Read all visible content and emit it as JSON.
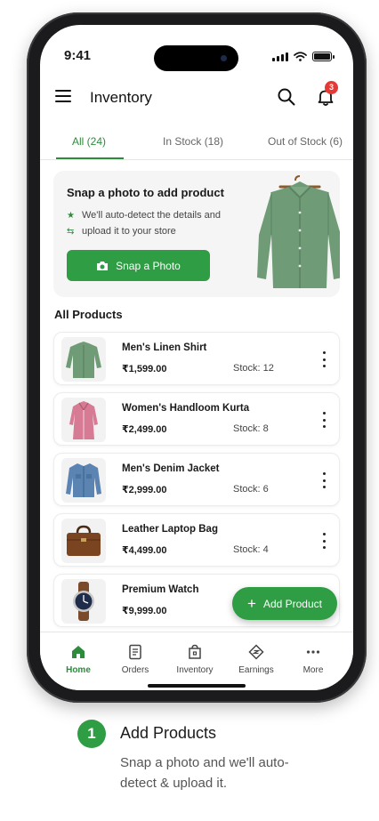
{
  "status_bar": {
    "time": "9:41"
  },
  "header": {
    "title": "Inventory",
    "notification_count": "3"
  },
  "tabs": [
    {
      "label": "All (24)",
      "active": true
    },
    {
      "label": "In Stock (18)",
      "active": false
    },
    {
      "label": "Out of Stock (6)",
      "active": false
    }
  ],
  "promo": {
    "title": "Snap a photo to add product",
    "line1": "We'll auto-detect the details and",
    "line2": "upload it to your store",
    "button_label": "Snap a Photo"
  },
  "products_section": {
    "title": "All Products"
  },
  "products": [
    {
      "name": "Men's Linen Shirt",
      "price": "₹1,599.00",
      "stock": "Stock: 12",
      "icon": "linen-shirt"
    },
    {
      "name": "Women's Handloom Kurta",
      "price": "₹2,499.00",
      "stock": "Stock: 8",
      "icon": "kurta"
    },
    {
      "name": "Men's Denim Jacket",
      "price": "₹2,999.00",
      "stock": "Stock: 6",
      "icon": "denim-jacket"
    },
    {
      "name": "Leather Laptop Bag",
      "price": "₹4,499.00",
      "stock": "Stock: 4",
      "icon": "laptop-bag"
    },
    {
      "name": "Premium Watch",
      "price": "₹9,999.00",
      "stock": "",
      "icon": "watch"
    }
  ],
  "fab": {
    "label": "Add Product"
  },
  "bottom_nav": [
    {
      "label": "Home",
      "icon": "home-icon",
      "active": true
    },
    {
      "label": "Orders",
      "icon": "orders-icon",
      "active": false
    },
    {
      "label": "Inventory",
      "icon": "inventory-icon",
      "active": false
    },
    {
      "label": "Earnings",
      "icon": "earnings-icon",
      "active": false
    },
    {
      "label": "More",
      "icon": "more-icon",
      "active": false
    }
  ],
  "caption": {
    "number": "1",
    "title": "Add Products",
    "description": "Snap a photo and we'll auto-detect & upload it."
  },
  "colors": {
    "accent": "#2e9d43",
    "badge": "#e53935"
  }
}
